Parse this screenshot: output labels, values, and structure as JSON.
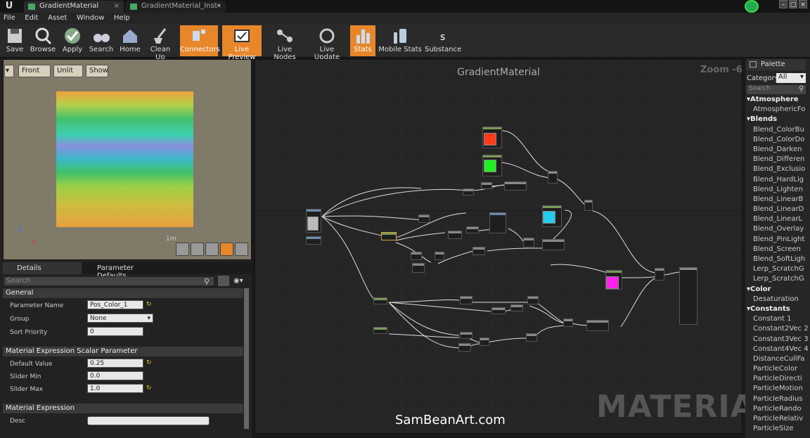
{
  "tabs": [
    {
      "label": "GradientMaterial",
      "active": true
    },
    {
      "label": "GradientMaterial_Inst•",
      "active": false
    }
  ],
  "menu": [
    "File",
    "Edit",
    "Asset",
    "Window",
    "Help"
  ],
  "toolbar": [
    {
      "label": "Save",
      "icon": "save-icon",
      "active": false
    },
    {
      "label": "Browse",
      "icon": "browse-icon",
      "active": false
    },
    {
      "label": "Apply",
      "icon": "apply-icon",
      "active": false
    },
    {
      "label": "Search",
      "icon": "binoculars-icon",
      "active": false
    },
    {
      "label": "Home",
      "icon": "home-icon",
      "active": false
    },
    {
      "label": "Clean Up",
      "icon": "broom-icon",
      "active": false
    },
    {
      "label": "Connectors",
      "icon": "connectors-icon",
      "active": true
    },
    {
      "label": "Live Preview",
      "icon": "live-preview-icon",
      "active": true
    },
    {
      "label": "Live Nodes",
      "icon": "live-nodes-icon",
      "active": false
    },
    {
      "label": "Live Update",
      "icon": "live-update-icon",
      "active": false
    },
    {
      "label": "Stats",
      "icon": "stats-icon",
      "active": true
    },
    {
      "label": "Mobile Stats",
      "icon": "mobile-stats-icon",
      "active": false
    },
    {
      "label": "Substance",
      "icon": "substance-icon",
      "active": false
    }
  ],
  "viewport": {
    "front_label": "Front",
    "unlit_label": "Unlit",
    "show_label": "Show",
    "scale_label": "1m",
    "axis_z": "Z",
    "axis_x": "X"
  },
  "details": {
    "tab_details": "Details",
    "tab_params": "Parameter Defaults",
    "search_placeholder": "Search",
    "sections": {
      "general": "General",
      "scalar": "Material Expression Scalar Parameter",
      "expression": "Material Expression"
    },
    "props": {
      "parameter_name_label": "Parameter Name",
      "parameter_name_value": "Pos_Color_1",
      "group_label": "Group",
      "group_value": "None",
      "sort_priority_label": "Sort Priority",
      "sort_priority_value": "0",
      "default_value_label": "Default Value",
      "default_value_value": "0.25",
      "slider_min_label": "Slider Min",
      "slider_min_value": "0.0",
      "slider_max_label": "Slider Max",
      "slider_max_value": "1.0",
      "desc_label": "Desc"
    }
  },
  "graph": {
    "title": "GradientMaterial",
    "zoom": "Zoom -6",
    "watermark": "MATERIAL",
    "credit": "SamBeanArt.com",
    "colors": {
      "red": "#ff3a1a",
      "green": "#22ee22",
      "cyan": "#22ccee",
      "magenta": "#ff22ee"
    }
  },
  "palette": {
    "title": "Palette",
    "category_label": "Category:",
    "category_value": "All",
    "search_placeholder": "Search",
    "groups": [
      {
        "name": "Atmosphere",
        "items": [
          "AtmosphericFo"
        ]
      },
      {
        "name": "Blends",
        "items": [
          "Blend_ColorBu",
          "Blend_ColorDo",
          "Blend_Darken",
          "Blend_Differen",
          "Blend_Exclusio",
          "Blend_HardLig",
          "Blend_Lighten",
          "Blend_LinearB",
          "Blend_LinearD",
          "Blend_LinearL",
          "Blend_Overlay",
          "Blend_PinLight",
          "Blend_Screen",
          "Blend_SoftLigh",
          "Lerp_ScratchG",
          "Lerp_ScratchG"
        ]
      },
      {
        "name": "Color",
        "items": [
          "Desaturation"
        ]
      },
      {
        "name": "Constants",
        "items": [
          "Constant      1",
          "Constant2Vec 2",
          "Constant3Vec 3",
          "Constant4Vec 4",
          "DistanceCullFa",
          "ParticleColor",
          "ParticleDirecti",
          "ParticleMotion",
          "ParticleRadius",
          "ParticleRando",
          "ParticleRelativ",
          "ParticleSize"
        ]
      }
    ]
  }
}
